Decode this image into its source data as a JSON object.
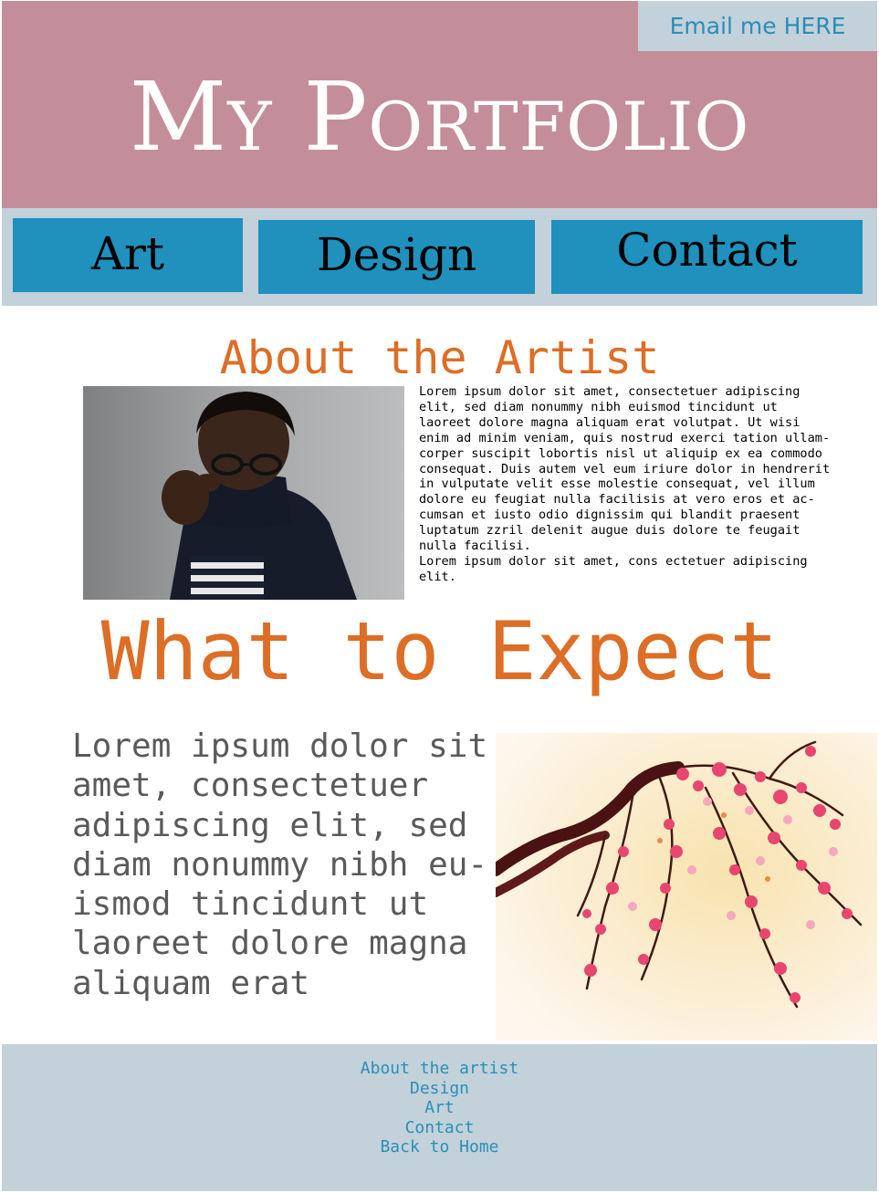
{
  "header": {
    "email_link": "Email me HERE",
    "title": "My Portfolio"
  },
  "nav": {
    "items": [
      {
        "label": "Art"
      },
      {
        "label": "Design"
      },
      {
        "label": "Contact"
      }
    ]
  },
  "about": {
    "heading": "About the Artist",
    "text": "Lorem ipsum dolor sit amet, consectetuer adipiscing\nelit, sed diam nonummy nibh euismod tincidunt ut\nlaoreet dolore magna aliquam erat volutpat. Ut wisi\nenim ad minim veniam, quis nostrud exerci tation ullam-\ncorper suscipit lobortis nisl ut aliquip ex ea commodo\nconsequat. Duis autem vel eum iriure dolor in hendrerit\nin vulputate velit esse molestie consequat, vel illum\ndolore eu feugiat nulla facilisis at vero eros et ac-\ncumsan et iusto odio dignissim qui blandit praesent\nluptatum zzril delenit augue duis dolore te feugait\nnulla facilisi.\nLorem ipsum dolor sit amet, cons ectetuer adipiscing\nelit."
  },
  "expect": {
    "heading": "What to Expect",
    "text": "Lorem ipsum dolor sit\namet, consectetuer\nadipiscing elit, sed\ndiam nonummy nibh eu-\nismod tincidunt ut\nlaoreet dolore magna\naliquam erat"
  },
  "footer": {
    "links": [
      {
        "label": "About the artist"
      },
      {
        "label": "Design"
      },
      {
        "label": "Art"
      },
      {
        "label": "Contact"
      },
      {
        "label": "Back to Home"
      }
    ]
  },
  "colors": {
    "header_bg": "#c38e9a",
    "panel_bg": "#c2d1da",
    "nav_button": "#2090bc",
    "accent_orange": "#dd6e26",
    "link_blue": "#2a8eb8"
  }
}
